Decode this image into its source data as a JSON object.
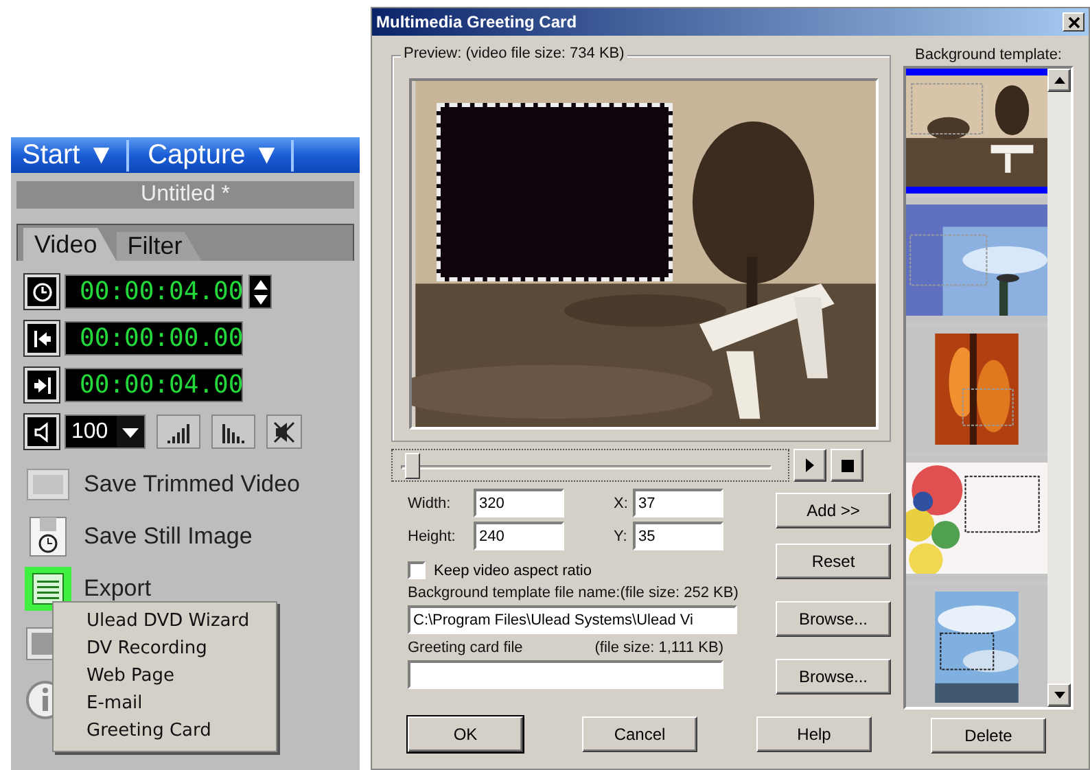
{
  "left_panel": {
    "menu_tabs": [
      {
        "label": "Start",
        "arrow": "▼"
      },
      {
        "label": "Capture",
        "arrow": "▼"
      }
    ],
    "project_title": "Untitled *",
    "tabs": [
      {
        "label": "Video",
        "selected": true
      },
      {
        "label": "Filter",
        "selected": false
      }
    ],
    "timecodes": [
      {
        "kind": "duration",
        "value": "00:00:04.00",
        "spinner": true
      },
      {
        "kind": "mark_in",
        "value": "00:00:00.00",
        "spinner": false
      },
      {
        "kind": "mark_out",
        "value": "00:00:04.00",
        "spinner": false
      }
    ],
    "volume": {
      "value": "100"
    },
    "actions": [
      {
        "kind": "film",
        "label": "Save Trimmed Video",
        "highlighted": false
      },
      {
        "kind": "disk",
        "label": "Save Still Image",
        "highlighted": false
      },
      {
        "kind": "export",
        "label": "Export",
        "highlighted": true
      }
    ],
    "export_menu": [
      "Ulead DVD Wizard",
      "DV Recording",
      "Web Page",
      "E-mail",
      "Greeting Card"
    ]
  },
  "dialog": {
    "title": "Multimedia Greeting Card",
    "preview_label": "Preview: (video file size: 734 KB)",
    "preview_slider": {
      "level": 0.03
    },
    "fields": [
      {
        "label": "Width:",
        "value": "320"
      },
      {
        "label": "X:",
        "value": "37"
      },
      {
        "label": "Height:",
        "value": "240"
      },
      {
        "label": "Y:",
        "value": "35"
      }
    ],
    "keep_aspect": {
      "label": "Keep video aspect ratio",
      "checked": false
    },
    "background_label": "Background template file name:(file size: 252 KB)",
    "background_path": "C:\\Program Files\\Ulead Systems\\Ulead Vi",
    "greeting_label": "Greeting card file",
    "greeting_size": "(file size: 1,111 KB)",
    "side_buttons": [
      "Add >>",
      "Reset",
      "Browse...",
      "Browse..."
    ],
    "bottom_buttons": [
      "OK",
      "Cancel",
      "Help"
    ],
    "template_label": "Background template:",
    "templates": [
      {
        "kind": "park",
        "selected": true
      },
      {
        "kind": "sky",
        "selected": false
      },
      {
        "kind": "violin",
        "selected": false
      },
      {
        "kind": "party",
        "selected": false
      },
      {
        "kind": "clouds",
        "selected": false
      }
    ],
    "delete_button": "Delete"
  }
}
